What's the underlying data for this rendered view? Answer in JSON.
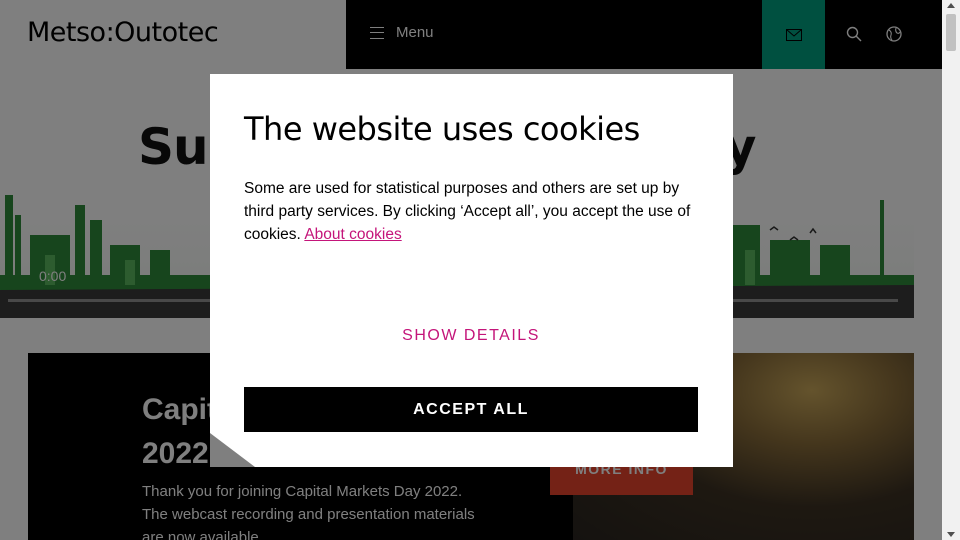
{
  "header": {
    "logo": "Metso:Outotec",
    "menu_label": "Menu",
    "icons": [
      "hamburger-icon",
      "mail-icon",
      "search-icon",
      "globe-icon"
    ],
    "accent_color": "#00a080"
  },
  "hero": {
    "title_left": "Sus",
    "title_right": "ty",
    "video_time": "0:00"
  },
  "card": {
    "title": "Capit 2022",
    "text": "Thank you for joining Capital Markets Day 2022. The webcast recording and presentation materials are now available.",
    "more_info": "MORE INFO",
    "button_color": "#e8452c"
  },
  "cookie_modal": {
    "title": "The website uses cookies",
    "text": "Some are used for statistical purposes and others are set up by third party services. By clicking ‘Accept all’, you accept the use of cookies.",
    "about_link": "About cookies",
    "show_details": "SHOW DETAILS",
    "accept_all": "ACCEPT ALL",
    "link_color": "#c4157a"
  }
}
